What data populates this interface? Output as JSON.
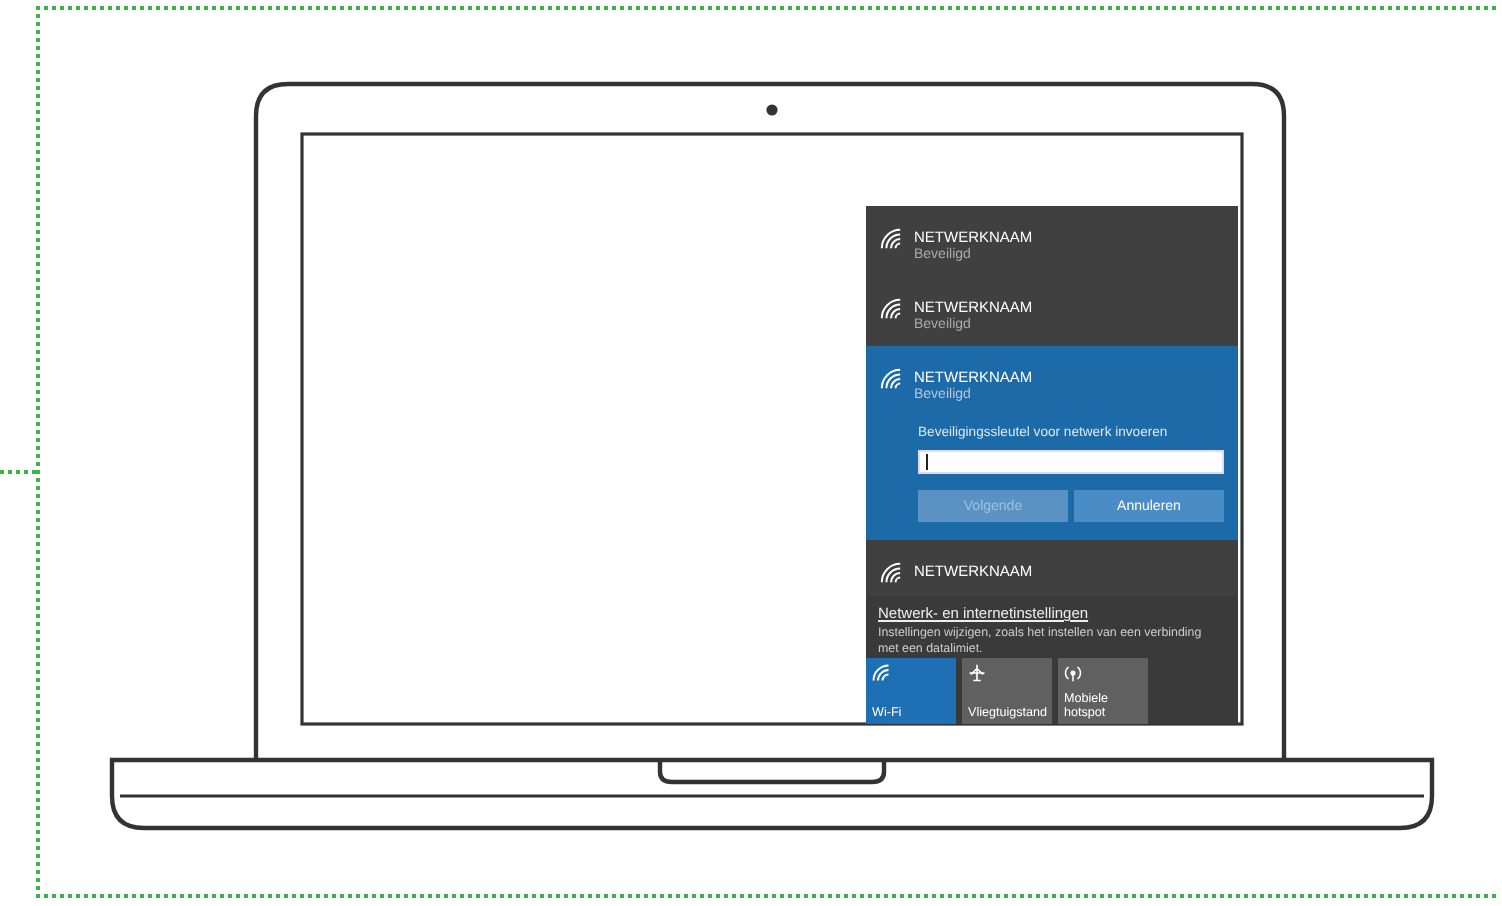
{
  "networks": [
    {
      "name": "NETWERKNAAM",
      "status": "Beveiligd",
      "selected": false
    },
    {
      "name": "NETWERKNAAM",
      "status": "Beveiligd",
      "selected": false
    },
    {
      "name": "NETWERKNAAM",
      "status": "Beveiligd",
      "selected": true,
      "key_prompt": "Beveiligingssleutel voor netwerk invoeren",
      "buttons": [
        {
          "label": "Volgende",
          "disabled": true
        },
        {
          "label": "Annuleren",
          "disabled": false
        }
      ]
    },
    {
      "name": "NETWERKNAAM",
      "selected": false
    }
  ],
  "settings": {
    "link": "Netwerk- en internetinstellingen",
    "description": "Instellingen wijzigen, zoals het instellen van een verbinding met een datalimiet."
  },
  "quick_actions": [
    {
      "kind": "wifi",
      "label": "Wi-Fi",
      "on": true
    },
    {
      "kind": "airplane",
      "label": "Vliegtuigstand",
      "on": false
    },
    {
      "kind": "hotspot",
      "label": "Mobiele hotspot",
      "on": false
    }
  ]
}
